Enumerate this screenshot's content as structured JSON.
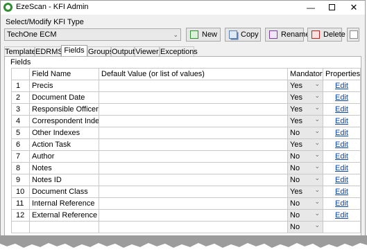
{
  "window": {
    "title": "EzeScan - KFI Admin",
    "controls": {
      "minimize": "—",
      "close": "✕"
    }
  },
  "selector": {
    "label": "Select/Modify KFI Type",
    "value": "TechOne ECM"
  },
  "toolbar": {
    "new_label": "New",
    "copy_label": "Copy",
    "rename_label": "Rename",
    "delete_label": "Delete"
  },
  "tabs": [
    {
      "label": "Template"
    },
    {
      "label": "EDRMS"
    },
    {
      "label": "Fields"
    },
    {
      "label": "Groups"
    },
    {
      "label": "Output"
    },
    {
      "label": "Viewer"
    },
    {
      "label": "Exceptions"
    }
  ],
  "active_tab": "Fields",
  "panel": {
    "header": "Fields",
    "columns": {
      "field_name": "Field Name",
      "default_value": "Default Value (or list of values)",
      "mandatory": "Mandatory",
      "properties": "Properties"
    },
    "rows": [
      {
        "num": "1",
        "name": "Precis",
        "default": "",
        "mandatory": "Yes",
        "props": "Edit"
      },
      {
        "num": "2",
        "name": "Document Date",
        "default": "",
        "mandatory": "Yes",
        "props": "Edit"
      },
      {
        "num": "3",
        "name": "Responsible Officer",
        "default": "",
        "mandatory": "Yes",
        "props": "Edit"
      },
      {
        "num": "4",
        "name": "Correspondent Index",
        "default": "",
        "mandatory": "Yes",
        "props": "Edit"
      },
      {
        "num": "5",
        "name": "Other Indexes",
        "default": "",
        "mandatory": "No",
        "props": "Edit"
      },
      {
        "num": "6",
        "name": "Action Task",
        "default": "",
        "mandatory": "Yes",
        "props": "Edit"
      },
      {
        "num": "7",
        "name": "Author",
        "default": "",
        "mandatory": "No",
        "props": "Edit"
      },
      {
        "num": "8",
        "name": "Notes",
        "default": "",
        "mandatory": "No",
        "props": "Edit"
      },
      {
        "num": "9",
        "name": "Notes ID",
        "default": "",
        "mandatory": "No",
        "props": "Edit"
      },
      {
        "num": "10",
        "name": "Document Class",
        "default": "",
        "mandatory": "Yes",
        "props": "Edit"
      },
      {
        "num": "11",
        "name": "Internal Reference",
        "default": "",
        "mandatory": "No",
        "props": "Edit"
      },
      {
        "num": "12",
        "name": "External Reference",
        "default": "",
        "mandatory": "No",
        "props": "Edit"
      },
      {
        "num": "",
        "name": "",
        "default": "",
        "mandatory": "No",
        "props": ""
      }
    ]
  },
  "colors": {
    "link": "#0645ad",
    "mandatory_cell_bg": "#e8e8e8",
    "window_bg": "#f0f0f0"
  }
}
